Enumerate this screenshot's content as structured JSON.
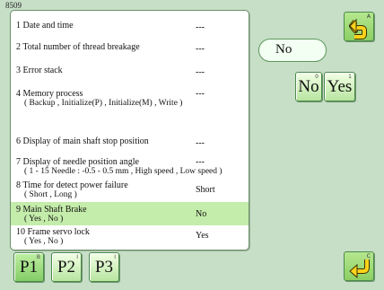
{
  "screen_id": "8509",
  "items": [
    {
      "label": "1 Date and time",
      "sub": "",
      "value": "---"
    },
    {
      "label": "2 Total number of thread breakage",
      "sub": "",
      "value": "---"
    },
    {
      "label": "3 Error stack",
      "sub": "",
      "value": "---"
    },
    {
      "label": "4 Memory process",
      "sub": "( Backup , Initialize(P) , Initialize(M) , Write )",
      "value": "---"
    },
    {
      "label": "6 Display of main shaft stop position",
      "sub": "",
      "value": "---"
    },
    {
      "label": "7 Display of needle position angle",
      "sub": "( 1 - 15 Needle : -0.5 - 0.5 mm , High speed , Low speed )",
      "value": "---"
    },
    {
      "label": "8 Time for detect power failure",
      "sub": "( Short , Long )",
      "value": "Short"
    },
    {
      "label": "9 Main Shaft Brake",
      "sub": "( Yes , No )",
      "value": "No"
    },
    {
      "label": "10 Frame servo lock",
      "sub": "( Yes , No )",
      "value": "Yes"
    }
  ],
  "selected_index": 7,
  "current_value": "No",
  "option_no": {
    "label": "No",
    "corner": "0"
  },
  "option_yes": {
    "label": "Yes",
    "corner": "1"
  },
  "page_tabs": [
    {
      "label": "P1",
      "corner": "B"
    },
    {
      "label": "P2",
      "corner": "I"
    },
    {
      "label": "P3",
      "corner": "I"
    }
  ],
  "return_button": {
    "icon": "return-arrow-icon",
    "corner": "A"
  },
  "enter_button": {
    "icon": "enter-arrow-icon",
    "corner": "C"
  },
  "colors": {
    "background": "#c7dec7",
    "highlight": "#c4ecaa",
    "icon_green": "#8ccf63",
    "arrow_yellow": "#ffd21a"
  }
}
